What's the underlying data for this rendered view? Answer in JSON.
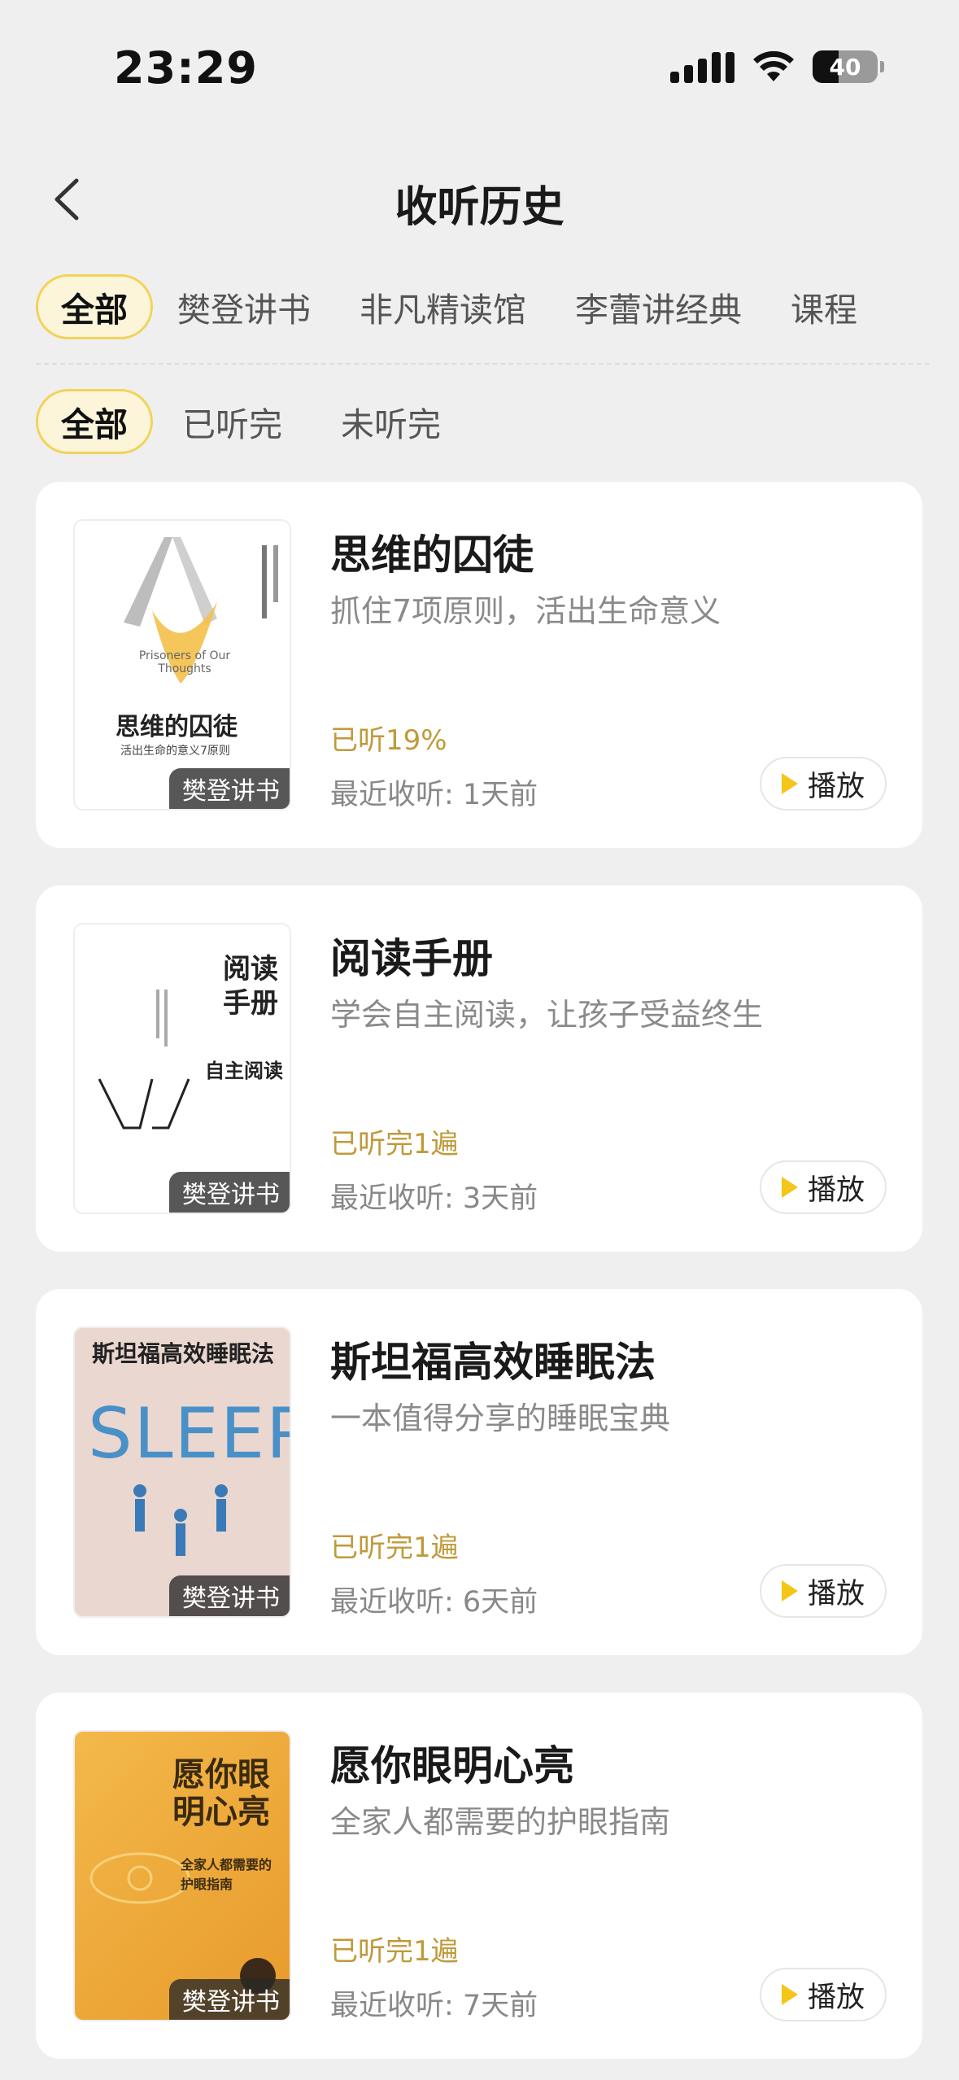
{
  "status": {
    "time": "23:29",
    "battery": "40"
  },
  "header": {
    "title": "收听历史"
  },
  "category_tabs": [
    "全部",
    "樊登讲书",
    "非凡精读馆",
    "李蕾讲经典",
    "课程"
  ],
  "status_tabs": [
    "全部",
    "已听完",
    "未听完"
  ],
  "items": [
    {
      "title": "思维的囚徒",
      "subtitle": "抓住7项原则，活出生命意义",
      "progress": "已听19%",
      "recent": "最近收听: 1天前",
      "badge": "樊登讲书",
      "play": "播放",
      "cover_title": "思维的囚徒",
      "cover_en": "Prisoners of Our Thoughts",
      "cover_sub": "活出生命的意义7原则"
    },
    {
      "title": "阅读手册",
      "subtitle": "学会自主阅读，让孩子受益终生",
      "progress": "已听完1遍",
      "recent": "最近收听: 3天前",
      "badge": "樊登讲书",
      "play": "播放",
      "cover_title": "阅读手册",
      "cover_sub": "自主阅读"
    },
    {
      "title": "斯坦福高效睡眠法",
      "subtitle": "一本值得分享的睡眠宝典",
      "progress": "已听完1遍",
      "recent": "最近收听: 6天前",
      "badge": "樊登讲书",
      "play": "播放",
      "cover_title": "斯坦福高效睡眠法",
      "cover_en": "SLEEP"
    },
    {
      "title": "愿你眼明心亮",
      "subtitle": "全家人都需要的护眼指南",
      "progress": "已听完1遍",
      "recent": "最近收听: 7天前",
      "badge": "樊登讲书",
      "play": "播放",
      "cover_title": "愿你眼明心亮",
      "cover_sub": "全家人都需要的护眼指南"
    }
  ]
}
